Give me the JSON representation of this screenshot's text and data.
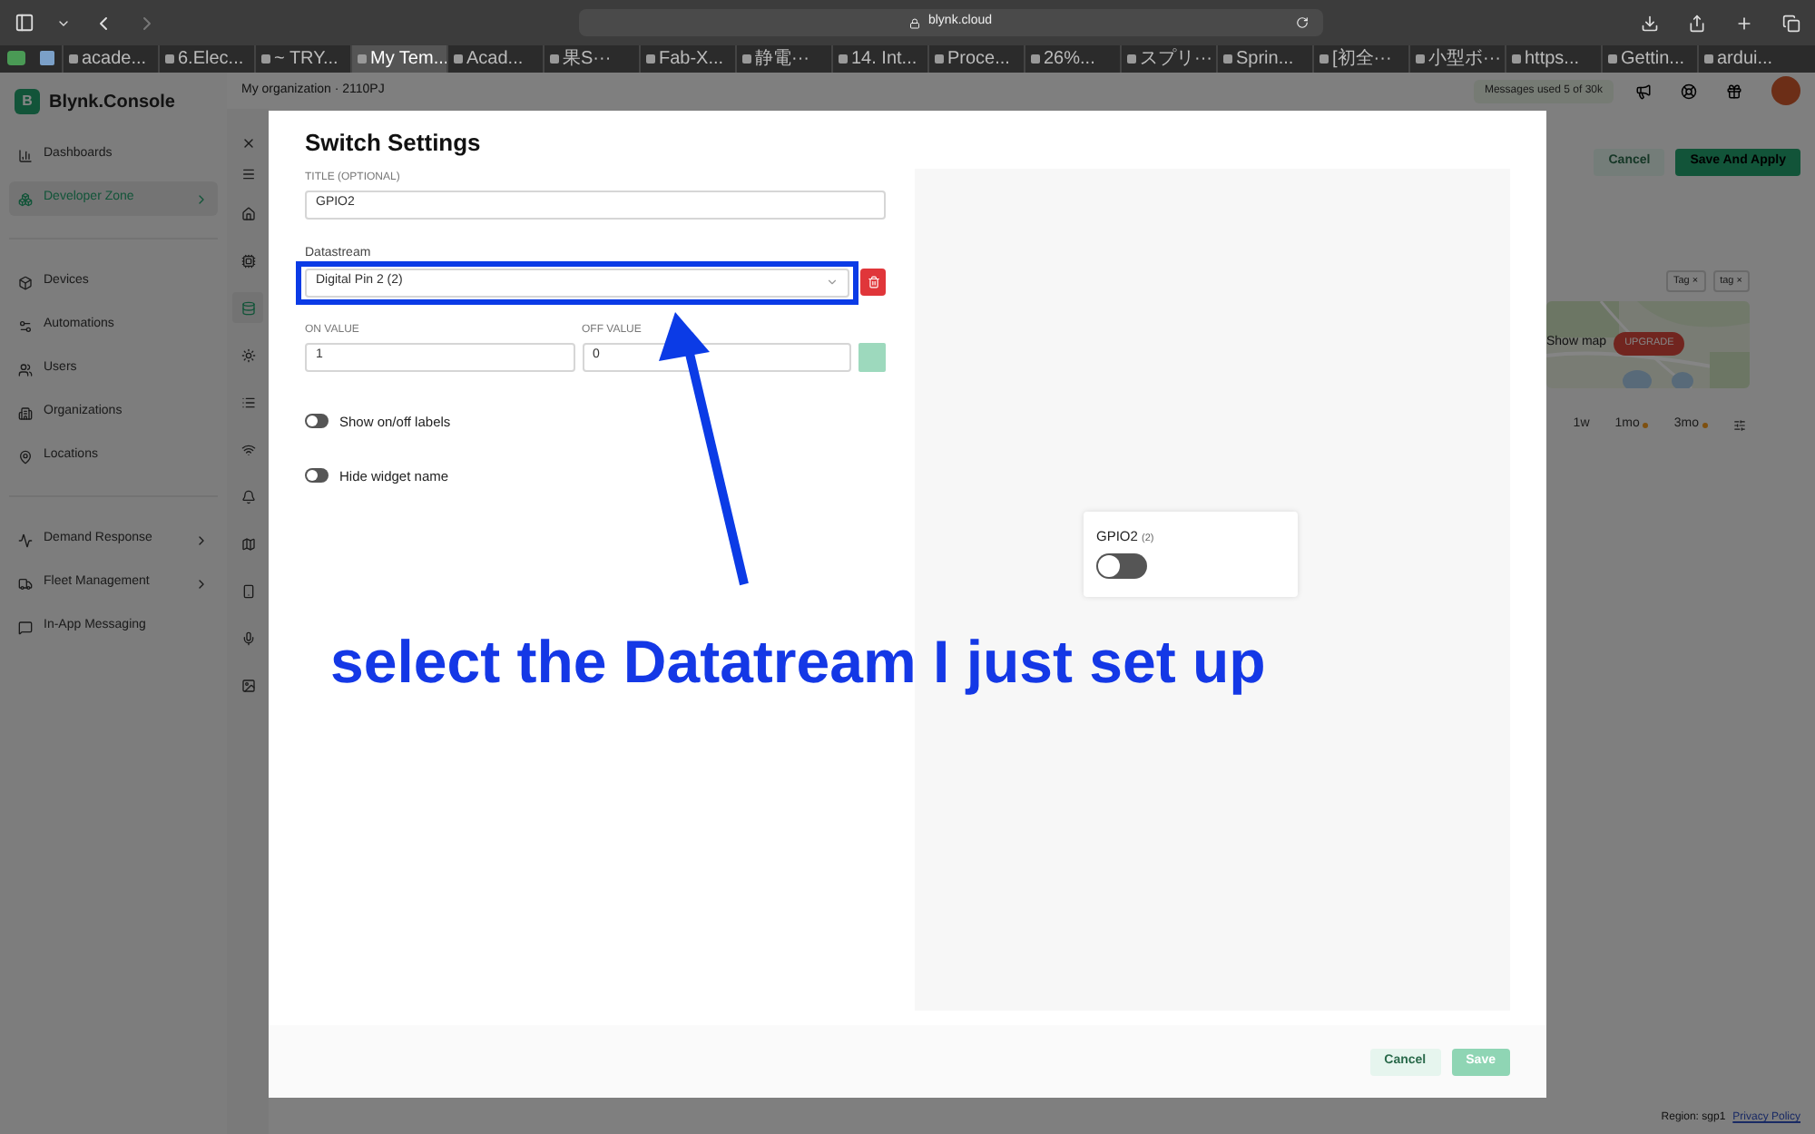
{
  "browser": {
    "url": "blynk.cloud",
    "tabs": [
      {
        "label": "acade...",
        "selected": false
      },
      {
        "label": "6.Elec...",
        "selected": false
      },
      {
        "label": "~ TRY...",
        "selected": false
      },
      {
        "label": "My Tem...",
        "selected": true
      },
      {
        "label": "Acad...",
        "selected": false
      },
      {
        "label": "果S···",
        "selected": false
      },
      {
        "label": "Fab-X...",
        "selected": false
      },
      {
        "label": "静電···",
        "selected": false
      },
      {
        "label": "14. Int...",
        "selected": false
      },
      {
        "label": "Proce...",
        "selected": false
      },
      {
        "label": "26%...",
        "selected": false
      },
      {
        "label": "スプリ···",
        "selected": false
      },
      {
        "label": "Sprin...",
        "selected": false
      },
      {
        "label": "[初全···",
        "selected": false
      },
      {
        "label": "小型ボ···",
        "selected": false
      },
      {
        "label": "https...",
        "selected": false
      },
      {
        "label": "Gettin...",
        "selected": false
      },
      {
        "label": "ardui...",
        "selected": false
      }
    ]
  },
  "app": {
    "logo_letter": "B",
    "logo": "Blynk.Console",
    "organization": "My organization · 2110PJ",
    "messages": "Messages used 5 of 30k",
    "sidebar": {
      "sections": [
        [
          {
            "label": "Dashboards",
            "selected": false,
            "expandable": false
          },
          {
            "label": "Developer Zone",
            "selected": true,
            "expandable": true
          }
        ],
        [
          {
            "label": "Devices",
            "selected": false,
            "expandable": false
          },
          {
            "label": "Automations",
            "selected": false,
            "expandable": false
          },
          {
            "label": "Users",
            "selected": false,
            "expandable": false
          },
          {
            "label": "Organizations",
            "selected": false,
            "expandable": false
          },
          {
            "label": "Locations",
            "selected": false,
            "expandable": false
          }
        ],
        [
          {
            "label": "Demand Response",
            "selected": false,
            "expandable": true
          },
          {
            "label": "Fleet Management",
            "selected": false,
            "expandable": true
          },
          {
            "label": "In-App Messaging",
            "selected": false,
            "expandable": false
          }
        ]
      ]
    },
    "icon_rail": [
      {
        "selected": false
      },
      {
        "selected": false
      },
      {
        "selected": true
      },
      {
        "selected": false
      },
      {
        "selected": false
      },
      {
        "selected": false
      },
      {
        "selected": false
      },
      {
        "selected": false
      },
      {
        "selected": false
      },
      {
        "selected": false
      },
      {
        "selected": false
      }
    ],
    "header_buttons": [
      "Cancel",
      "Save And Apply"
    ],
    "tags": [
      {
        "label": "Tag",
        "remove": "×"
      },
      {
        "label": "tag",
        "remove": "×"
      }
    ],
    "map": {
      "label": "Show map",
      "badge": "UPGRADE"
    },
    "time_ranges": [
      {
        "label": "1w",
        "locked": false
      },
      {
        "label": "1mo",
        "locked": true
      },
      {
        "label": "3mo",
        "locked": true
      }
    ],
    "footer": {
      "region": "Region: sgp1",
      "link": "Privacy Policy"
    }
  },
  "modal": {
    "title": "Switch Settings",
    "title_field": {
      "label": "TITLE (OPTIONAL)",
      "value": "GPIO2"
    },
    "datastream": {
      "label": "Datastream",
      "value": "Digital Pin 2 (2)"
    },
    "on_value": {
      "label": "ON VALUE",
      "value": "1"
    },
    "off_value": {
      "label": "OFF VALUE",
      "value": "0"
    },
    "toggles": [
      {
        "label": "Show on/off labels",
        "on": false
      },
      {
        "label": "Hide widget name",
        "on": false
      }
    ],
    "preview": {
      "name": "GPIO2",
      "pin": "(2)",
      "on": false
    },
    "buttons": [
      {
        "label": "Cancel",
        "kind": "secondary",
        "disabled": false
      },
      {
        "label": "Save",
        "kind": "primary",
        "disabled": true
      }
    ]
  },
  "annotation": {
    "caption": "select the Datatream I just set up"
  }
}
